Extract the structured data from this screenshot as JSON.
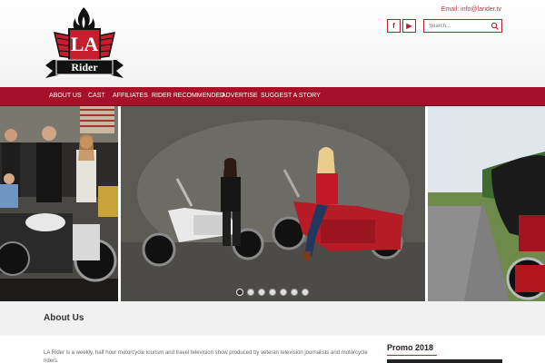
{
  "header": {
    "email": "Email: info@larider.tv",
    "logo_text_top": "LA",
    "logo_text_bottom": "Rider",
    "social": [
      {
        "label": "f",
        "icon": "facebook-icon"
      },
      {
        "label": "▶",
        "icon": "youtube-icon"
      }
    ],
    "search_placeholder": "Search..."
  },
  "nav": {
    "items": [
      "About Us",
      "Cast",
      "Affiliates",
      "Rider Recommended",
      "Advertise",
      "Suggest a Story"
    ]
  },
  "slider": {
    "slide_count": 7,
    "active_index": 0
  },
  "about": {
    "title": "About Us",
    "text": "LA Rider is a weekly, half hour motorcycle tourism and travel television show produced by veteran television journalists and motorcycle riders."
  },
  "promo": {
    "title": "Promo 2018"
  },
  "colors": {
    "brand_red": "#a6112a",
    "link_red": "#c4343e"
  }
}
